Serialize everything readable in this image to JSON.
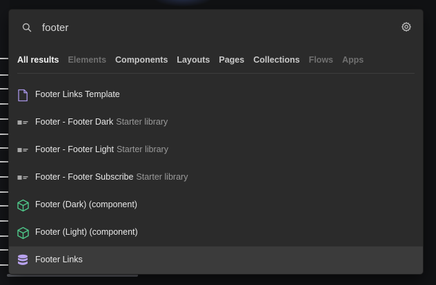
{
  "search": {
    "value": "footer",
    "icon": "search-icon"
  },
  "settings_icon": "gear-icon",
  "tabs": [
    {
      "label": "All results",
      "state": "active"
    },
    {
      "label": "Elements",
      "state": "dim"
    },
    {
      "label": "Components",
      "state": "normal"
    },
    {
      "label": "Layouts",
      "state": "normal"
    },
    {
      "label": "Pages",
      "state": "normal"
    },
    {
      "label": "Collections",
      "state": "normal"
    },
    {
      "label": "Flows",
      "state": "dim"
    },
    {
      "label": "Apps",
      "state": "dim"
    }
  ],
  "results": [
    {
      "title": "Footer Links Template",
      "subtitle": "",
      "icon": "page-template-icon"
    },
    {
      "title": "Footer - Footer Dark",
      "subtitle": "Starter library",
      "icon": "layout-block-icon"
    },
    {
      "title": "Footer - Footer Light",
      "subtitle": "Starter library",
      "icon": "layout-block-icon"
    },
    {
      "title": "Footer - Footer Subscribe",
      "subtitle": "Starter library",
      "icon": "layout-block-icon"
    },
    {
      "title": "Footer (Dark) (component)",
      "subtitle": "",
      "icon": "component-cube-icon"
    },
    {
      "title": "Footer (Light) (component)",
      "subtitle": "",
      "icon": "component-cube-icon"
    },
    {
      "title": "Footer Links",
      "subtitle": "",
      "icon": "collection-database-icon",
      "selected": true
    }
  ],
  "colors": {
    "component_icon": "#4fc88a",
    "collection_icon": "#b9a3f0",
    "page_icon": "#a996e8"
  }
}
